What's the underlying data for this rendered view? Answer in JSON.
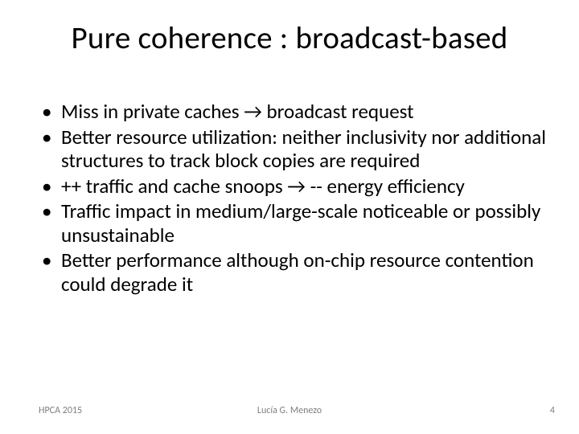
{
  "title": "Pure coherence : broadcast-based",
  "bullets": [
    "Miss in private caches → broadcast request",
    "Better resource utilization: neither inclusivity nor additional structures to track block copies are required",
    "++ traffic and cache snoops → -- energy efficiency",
    "Traffic impact in medium/large-scale noticeable or possibly unsustainable",
    "Better performance although on-chip resource contention could degrade it"
  ],
  "footer": {
    "left": "HPCA 2015",
    "center": "Lucía G. Menezo",
    "right": "4"
  }
}
